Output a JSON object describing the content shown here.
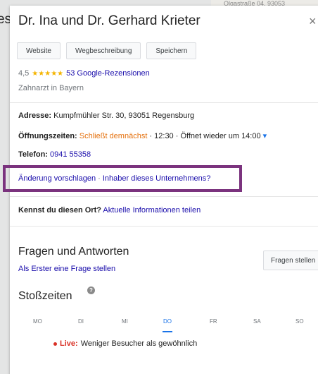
{
  "background": {
    "map_text": "Olgastraße 04, 93053",
    "prefix_text": "es"
  },
  "header": {
    "title": "Dr. Ina und Dr. Gerhard Krieter",
    "close_symbol": "×"
  },
  "actions": {
    "website_label": "Website",
    "directions_label": "Wegbeschreibung",
    "save_label": "Speichern"
  },
  "rating": {
    "value": "4,5",
    "stars": "★★★★★",
    "reviews_label": "53 Google-Rezensionen"
  },
  "category": "Zahnarzt in Bayern",
  "details": {
    "address_label": "Adresse:",
    "address_value": " Kumpfmühler Str. 30, 93051 Regensburg",
    "hours_label": "Öffnungszeiten:",
    "hours_status": " Schließt demnächst",
    "hours_rest": " · 12:30 · Öffnet wieder um 14:00",
    "hours_dropdown_symbol": "▾",
    "phone_label": "Telefon:",
    "phone_value": " 0941 55358"
  },
  "suggest": {
    "edit_link": "Änderung vorschlagen",
    "separator": " · ",
    "owner_link": "Inhaber dieses Unternehmens?"
  },
  "know_place": {
    "question": "Kennst du diesen Ort?",
    "link": " Aktuelle Informationen teilen"
  },
  "qa": {
    "title": "Fragen und Antworten",
    "first_question_link": "Als Erster eine Frage stellen",
    "ask_button": "Fragen stellen"
  },
  "popular_times": {
    "title": "Stoßzeiten",
    "help_symbol": "?",
    "days": [
      "MO",
      "DI",
      "MI",
      "DO",
      "FR",
      "SA",
      "SO"
    ],
    "active_day": "DO",
    "live_label": "Live:",
    "live_text": " Weniger Besucher als gewöhnlich"
  },
  "colors": {
    "accent_blue": "#1a73e8",
    "link_blue": "#1a0dab",
    "closing_orange": "#e5710e",
    "live_red": "#d93025",
    "star_gold": "#f4b400",
    "highlight_purple": "#7b337e"
  }
}
